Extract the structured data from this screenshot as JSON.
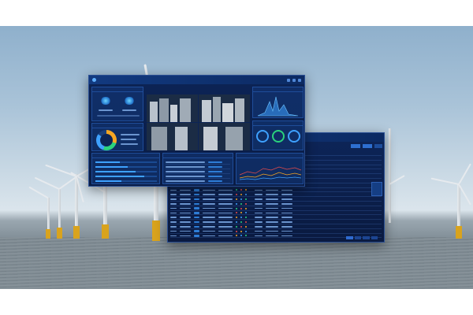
{
  "front_panel": {
    "title": "",
    "nav_items": [
      "",
      "",
      "",
      "",
      "",
      "",
      ""
    ],
    "cards": {
      "device_status": "",
      "alarm_stats": "",
      "video": "",
      "trend": "",
      "list": "",
      "events": "",
      "analysis": ""
    }
  },
  "back_panel": {
    "tabs": [
      "",
      "",
      ""
    ]
  },
  "colors": {
    "panel_bg": "#0b1f4a",
    "accent": "#3ea1ff",
    "border": "#2a4f94",
    "warn": "#f5a623",
    "ok": "#2bd27d",
    "alarm": "#e84b4b"
  },
  "icons": [
    "logo-icon",
    "settings-icon",
    "user-icon",
    "bell-icon"
  ]
}
